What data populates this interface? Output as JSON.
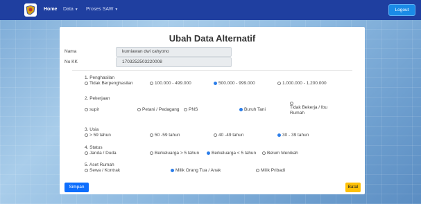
{
  "navbar": {
    "home": "Home",
    "data_menu": "Data",
    "proses_menu": "Proses SAW",
    "logout": "Logout",
    "colors": {
      "bar": "#1f3fa0",
      "logout": "#1a8be6"
    }
  },
  "form": {
    "title": "Ubah Data Alternatif",
    "nama_label": "Nama",
    "nama_value": "kurniawan dwi cahyono",
    "nokk_label": "No KK",
    "nokk_value": "1703252503220008"
  },
  "criteria": [
    {
      "label": "1. Penghasilan",
      "options": [
        {
          "text": "Tidak Berpenghasilan",
          "selected": false
        },
        {
          "text": "100.000 - 499.000",
          "selected": false
        },
        {
          "text": "500.000 - 999.000",
          "selected": true
        },
        {
          "text": "1.000.000 - 1.200.000",
          "selected": false
        }
      ]
    },
    {
      "label": "2. Pekerjaan",
      "options": [
        {
          "text": "supir",
          "selected": false
        },
        {
          "text": "Petani / Pedagang",
          "selected": false
        },
        {
          "text": "PNS",
          "selected": false
        },
        {
          "text": "Buruh Tani",
          "selected": true
        },
        {
          "text": "Tidak Bekerja / Ibu Rumah",
          "selected": false
        }
      ]
    },
    {
      "label": "3. Usia",
      "options": [
        {
          "text": "> 59 tahun",
          "selected": false
        },
        {
          "text": "50 -59 tahun",
          "selected": false
        },
        {
          "text": "40 -49 tahun",
          "selected": false
        },
        {
          "text": "30 - 39 tahun",
          "selected": true
        }
      ]
    },
    {
      "label": "4. Status",
      "options": [
        {
          "text": "Janda / Duda",
          "selected": false
        },
        {
          "text": "Berkeluarga > 5 tahun",
          "selected": false
        },
        {
          "text": "Berkeluarga < 5 tahun",
          "selected": true
        },
        {
          "text": "Belum Menikah",
          "selected": false
        }
      ]
    },
    {
      "label": "5. Aset Rumah",
      "options": [
        {
          "text": "Sewa / Kontrak",
          "selected": false
        },
        {
          "text": "Milik Orang Tua / Anak",
          "selected": true
        },
        {
          "text": "Milik Pribadi",
          "selected": false
        }
      ]
    }
  ],
  "buttons": {
    "simpan": "Simpan",
    "batal": "Batal",
    "simpan_color": "#0d6efd",
    "batal_color": "#ffc107"
  }
}
